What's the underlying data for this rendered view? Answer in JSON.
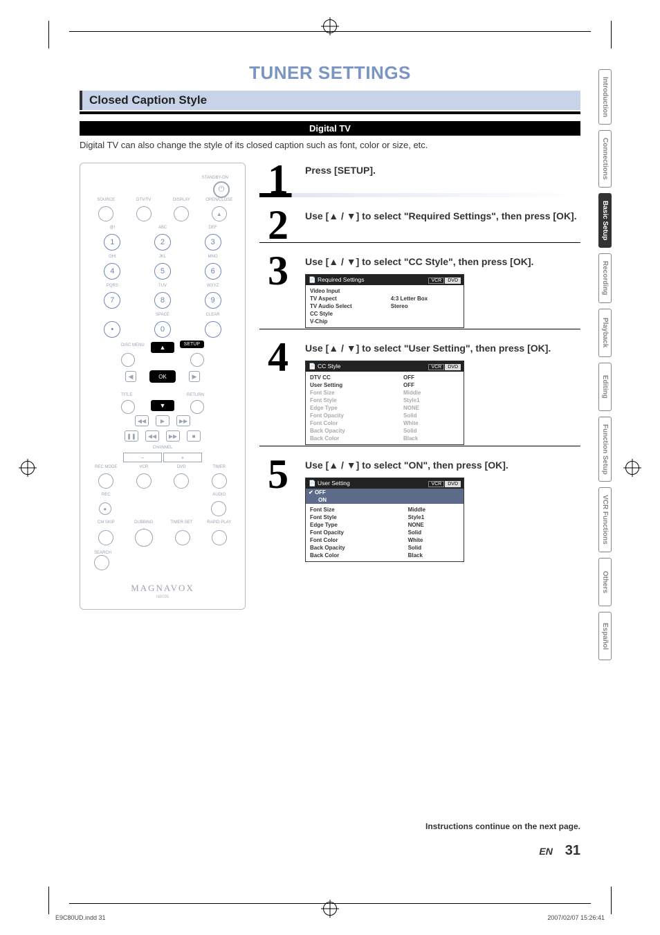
{
  "title": "TUNER SETTINGS",
  "section": "Closed Caption Style",
  "black_bar": "Digital TV",
  "intro": "Digital TV can also change the style of its closed caption such as font, color or size, etc.",
  "remote": {
    "standby": "STANDBY-ON",
    "row1": [
      "SOURCE",
      "DTV/TV",
      "DISPLAY",
      "OPEN/CLOSE"
    ],
    "row2_labels": [
      "@!",
      "ABC",
      "DEF"
    ],
    "row3_labels": [
      "GHI",
      "JKL",
      "MNO"
    ],
    "row4_labels": [
      "PQRS",
      "TUV",
      "WXYZ"
    ],
    "row5_labels": [
      "",
      "SPACE",
      "CLEAR"
    ],
    "discmenu": "DISC MENU",
    "setup": "SETUP",
    "ok": "OK",
    "title_lbl": "TITLE",
    "return_lbl": "RETURN",
    "channel": "CHANNEL",
    "modes": [
      "REC MODE",
      "VCR",
      "DVD",
      "TIMER"
    ],
    "rec": "REC",
    "audio": "AUDIO",
    "bottom": [
      "CM SKIP",
      "DUBBING",
      "TIMER SET",
      "RAPID PLAY"
    ],
    "search": "SEARCH",
    "logo": "MAGNAVOX",
    "logo_sub": "NB095"
  },
  "steps": {
    "s1": {
      "num": "1",
      "instr": "Press [SETUP]."
    },
    "s2": {
      "num": "2",
      "instr": "Use [▲ / ▼] to select \"Required Settings\", then press [OK]."
    },
    "s3": {
      "num": "3",
      "instr": "Use [▲ / ▼] to select \"CC Style\", then press [OK].",
      "osd_title": "Required Settings",
      "tabs": [
        "VCR",
        "DVD"
      ],
      "rows": [
        {
          "k": "Video Input",
          "v": ""
        },
        {
          "k": "TV Aspect",
          "v": "4:3 Letter Box"
        },
        {
          "k": "TV Audio Select",
          "v": "Stereo"
        },
        {
          "k": "CC Style",
          "v": ""
        },
        {
          "k": "V-Chip",
          "v": ""
        }
      ]
    },
    "s4": {
      "num": "4",
      "instr": "Use [▲ / ▼] to select \"User Setting\", then press [OK].",
      "osd_title": "CC Style",
      "tabs": [
        "VCR",
        "DVD"
      ],
      "rows": [
        {
          "k": "DTV CC",
          "v": "OFF",
          "bold": true
        },
        {
          "k": "User Setting",
          "v": "OFF",
          "bold": true
        },
        {
          "k": "Font Size",
          "v": "Middle",
          "dim": true
        },
        {
          "k": "Font Style",
          "v": "Style1",
          "dim": true
        },
        {
          "k": "Edge Type",
          "v": "NONE",
          "dim": true
        },
        {
          "k": "Font Opacity",
          "v": "Solid",
          "dim": true
        },
        {
          "k": "Font Color",
          "v": "White",
          "dim": true
        },
        {
          "k": "Back Opacity",
          "v": "Solid",
          "dim": true
        },
        {
          "k": "Back Color",
          "v": "Black",
          "dim": true
        }
      ]
    },
    "s5": {
      "num": "5",
      "instr": "Use [▲ / ▼] to select \"ON\", then press [OK].",
      "osd_title": "User Setting",
      "tabs": [
        "VCR",
        "DVD"
      ],
      "hl_rows": [
        {
          "k": "OFF",
          "check": true
        },
        {
          "k": "ON"
        }
      ],
      "rows": [
        {
          "k": "Font Size",
          "v": "Middle"
        },
        {
          "k": "Font Style",
          "v": "Style1"
        },
        {
          "k": "Edge Type",
          "v": "NONE"
        },
        {
          "k": "Font Opacity",
          "v": "Solid"
        },
        {
          "k": "Font Color",
          "v": "White"
        },
        {
          "k": "Back Opacity",
          "v": "Solid"
        },
        {
          "k": "Back Color",
          "v": "Black"
        }
      ]
    }
  },
  "side_tabs": [
    "Introduction",
    "Connections",
    "Basic Setup",
    "Recording",
    "Playback",
    "Editing",
    "Function Setup",
    "VCR Functions",
    "Others",
    "Español"
  ],
  "active_tab_index": 2,
  "continue_note": "Instructions continue on the next page.",
  "page_lang": "EN",
  "page_number": "31",
  "footer_left": "E9C80UD.indd   31",
  "footer_right": "2007/02/07   15:26:41"
}
